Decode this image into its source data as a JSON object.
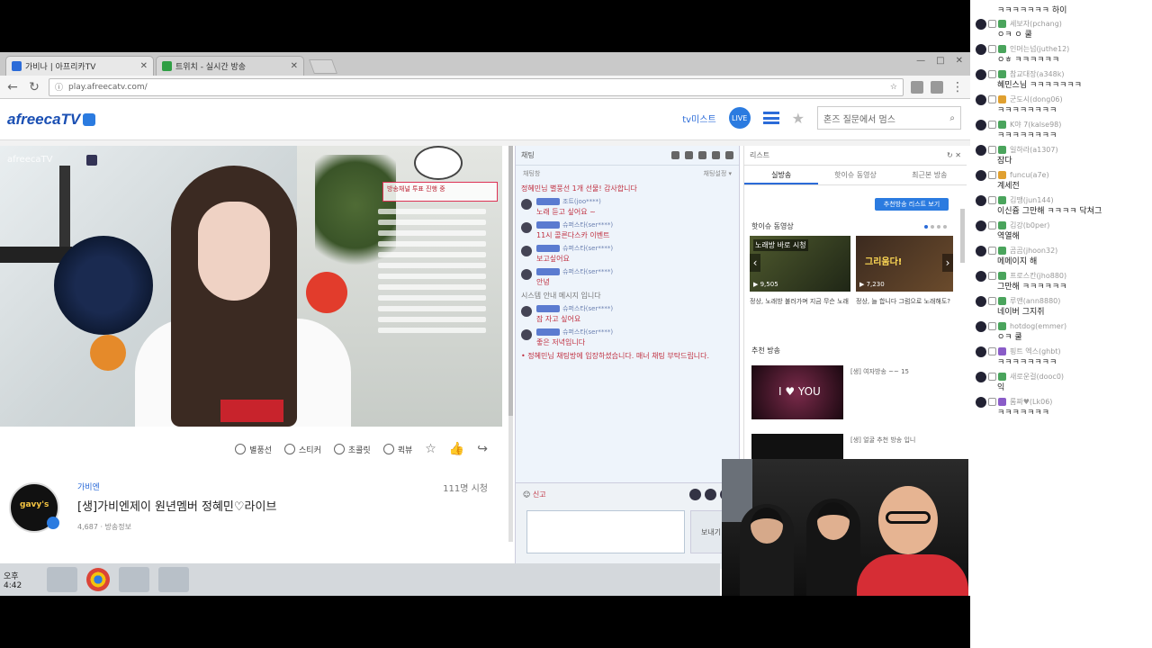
{
  "browser": {
    "tabs": [
      {
        "label": "가비나 | 아프리카TV",
        "active": true,
        "fav_color": "#2b6bd8"
      },
      {
        "label": "트위치 - 실시간 방송",
        "active": false,
        "fav_color": "#2f9e44"
      }
    ],
    "url": "play.afreecatv.com/",
    "window_controls": [
      "—",
      "□",
      "✕"
    ]
  },
  "header": {
    "logo": "afreecaTV",
    "link": "tv미스트",
    "round_badge": "LIVE",
    "search_placeholder": "혼즈 질문에서 멈스"
  },
  "player": {
    "badge": "afreecaTV",
    "overlay_text": "방송채널 투표 진행 중"
  },
  "actions": [
    {
      "label": "별풍선",
      "name": "star-balloon-button"
    },
    {
      "label": "스티커",
      "name": "sticker-button"
    },
    {
      "label": "초콜릿",
      "name": "chocolate-button"
    },
    {
      "label": "퀵뷰",
      "name": "quickview-button"
    }
  ],
  "broadcast": {
    "bj_name": "가비엔",
    "title": "[생]가비엔제이 원년멤버 정혜민♡라이브",
    "viewers": "111명 시청",
    "meta": "4,687 · 방송정보",
    "avatar_text": "gavy's"
  },
  "chat": {
    "header": "채팅",
    "sub_left": "채팅창",
    "sub_right": "채팅설정 ▾",
    "messages": [
      {
        "name": "",
        "text": "정혜민님 별풍선 1개 선물! 감사합니다",
        "gray": false,
        "avatar": false
      },
      {
        "name": "조트(joo****)",
        "text": "노래 듣고 싶어요 ~",
        "gray": false,
        "avatar": true
      },
      {
        "name": "슈퍼스타(ser****)",
        "text": "11시 콜른다스카 이벤트",
        "gray": false,
        "avatar": true
      },
      {
        "name": "슈퍼스타(ser****)",
        "text": "보고싶어요",
        "gray": false,
        "avatar": true
      },
      {
        "name": "슈퍼스타(ser****)",
        "text": "안녕",
        "gray": false,
        "avatar": true
      },
      {
        "name": "",
        "text": "시스템 안내 메시지 입니다",
        "gray": true,
        "avatar": false
      },
      {
        "name": "슈퍼스타(ser****)",
        "text": "잠 자고 싶어요",
        "gray": false,
        "avatar": true
      },
      {
        "name": "슈퍼스타(ser****)",
        "text": "좋은 저녁입니다",
        "gray": false,
        "avatar": true
      },
      {
        "name": "",
        "text": "• 정혜민님 채팅방에 입장하셨습니다. 매너 채팅 부탁드립니다.",
        "gray": false,
        "avatar": false
      }
    ],
    "quick": "신고",
    "send_label": "보내기"
  },
  "recommend": {
    "header": "리스트",
    "tabs": [
      "실방송",
      "핫이슈 동영상",
      "최근본 방송"
    ],
    "active_tab": 0,
    "button": "추천방송 리스트 보기",
    "section1": "핫이슈 동영상",
    "thumb1_caption": "노래방 바로 시청",
    "thumb1_count": "▶ 9,505",
    "thumb2_caption": "그리움다!",
    "thumb2_count": "▶ 7,230",
    "thumb1_title": "정상, 노래방 불러가며 지금 무슨 노래",
    "thumb2_title": "정상, 늘 합니다 그럼으로 노래해도?",
    "section2": "추천 방송",
    "thumb3_caption": "I ♥ YOU",
    "thumb3_title": "[생] 여자방송 ~~ 15",
    "thumb4_title": "[생] 얼굴 추천 방송 입니"
  },
  "taskbar": {
    "time": "오후 4:42"
  },
  "rchat": {
    "top_line": "ㅋㅋㅋㅋㅋㅋㅋ 하이",
    "messages": [
      {
        "name": "세보자(pchang)",
        "text": "ㅇㅋ ㅇ 쿨",
        "badge": "#4aa45c"
      },
      {
        "name": "인머는넘(juthe12)",
        "text": "ㅇㅎ ㅋㅋㅋㅋㅋㅋ",
        "badge": "#4aa45c"
      },
      {
        "name": "참교대장(a348k)",
        "text": "혜민스님 ㅋㅋㅋㅋㅋㅋㅋ",
        "badge": "#4aa45c"
      },
      {
        "name": "군도시(dong06)",
        "text": "ㅋㅋㅋㅋㅋㅋㅋㅋ",
        "badge": "#e0a030"
      },
      {
        "name": "K야 7(kalse98)",
        "text": "ㅋㅋㅋㅋㅋㅋㅋㅋ",
        "badge": "#4aa45c"
      },
      {
        "name": "일하라(a1307)",
        "text": "잠다",
        "badge": "#4aa45c"
      },
      {
        "name": "funcu(a7e)",
        "text": "계세전",
        "badge": "#e0a030"
      },
      {
        "name": "김땡(jun144)",
        "text": "이신쥼 그만해 ㅋㅋㅋㅋ 닥쳐그",
        "badge": "#4aa45c"
      },
      {
        "name": "김강(b0per)",
        "text": "역열해",
        "badge": "#4aa45c"
      },
      {
        "name": "곰곰(jhoon32)",
        "text": "메메이지 해",
        "badge": "#4aa45c"
      },
      {
        "name": "프로스칸(jho880)",
        "text": "그만해 ㅋㅋㅋㅋㅋㅋ",
        "badge": "#4aa45c"
      },
      {
        "name": "루앤(ann8880)",
        "text": "네이버 그지쥐",
        "badge": "#4aa45c"
      },
      {
        "name": "hotdog(emmer)",
        "text": "ㅇㅋ 쿨",
        "badge": "#4aa45c"
      },
      {
        "name": "핑트 엑스(ghbt)",
        "text": "ㅋㅋㅋㅋㅋㅋㅋㅋ",
        "badge": "#8a5cc8"
      },
      {
        "name": "새로운걸(dooc0)",
        "text": "익",
        "badge": "#4aa45c"
      },
      {
        "name": "롬짜♥(Lk06)",
        "text": "ㅋㅋㅋㅋㅋㅋㅋ",
        "badge": "#8a5cc8"
      }
    ]
  }
}
